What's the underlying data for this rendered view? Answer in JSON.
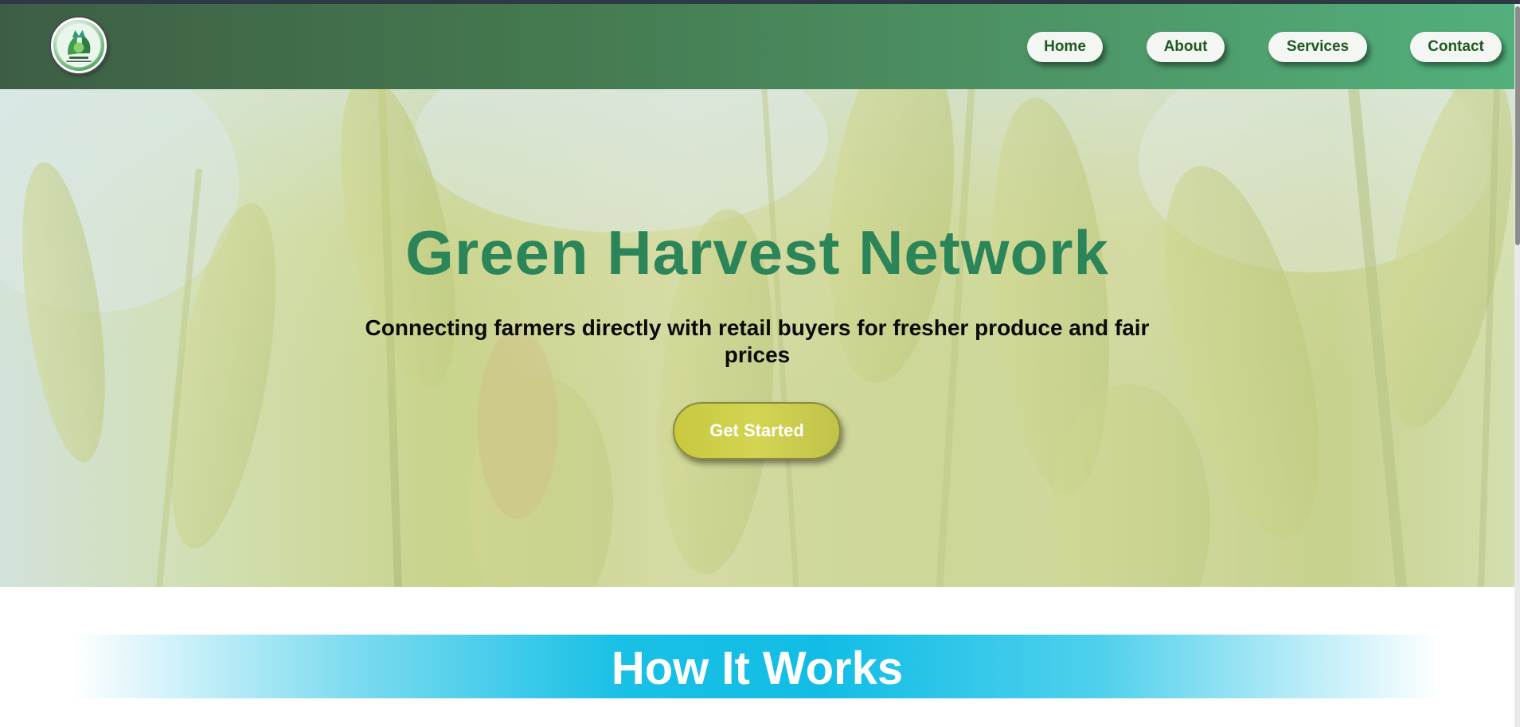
{
  "header": {
    "logo_icon": "green-harvest-logo",
    "nav": [
      {
        "label": "Home"
      },
      {
        "label": "About"
      },
      {
        "label": "Services"
      },
      {
        "label": "Contact"
      }
    ]
  },
  "hero": {
    "title": "Green Harvest Network",
    "subtitle": "Connecting farmers directly with retail buyers for fresher produce and fair prices",
    "cta_label": "Get Started"
  },
  "how_it_works": {
    "title": "How It Works"
  },
  "colors": {
    "header_start": "#3d5e45",
    "header_end": "#52b07c",
    "title_green": "#2b8558",
    "nav_text": "#1d5a1d",
    "cta_yellow": "#d3d452",
    "band_cyan": "#12bde5"
  }
}
